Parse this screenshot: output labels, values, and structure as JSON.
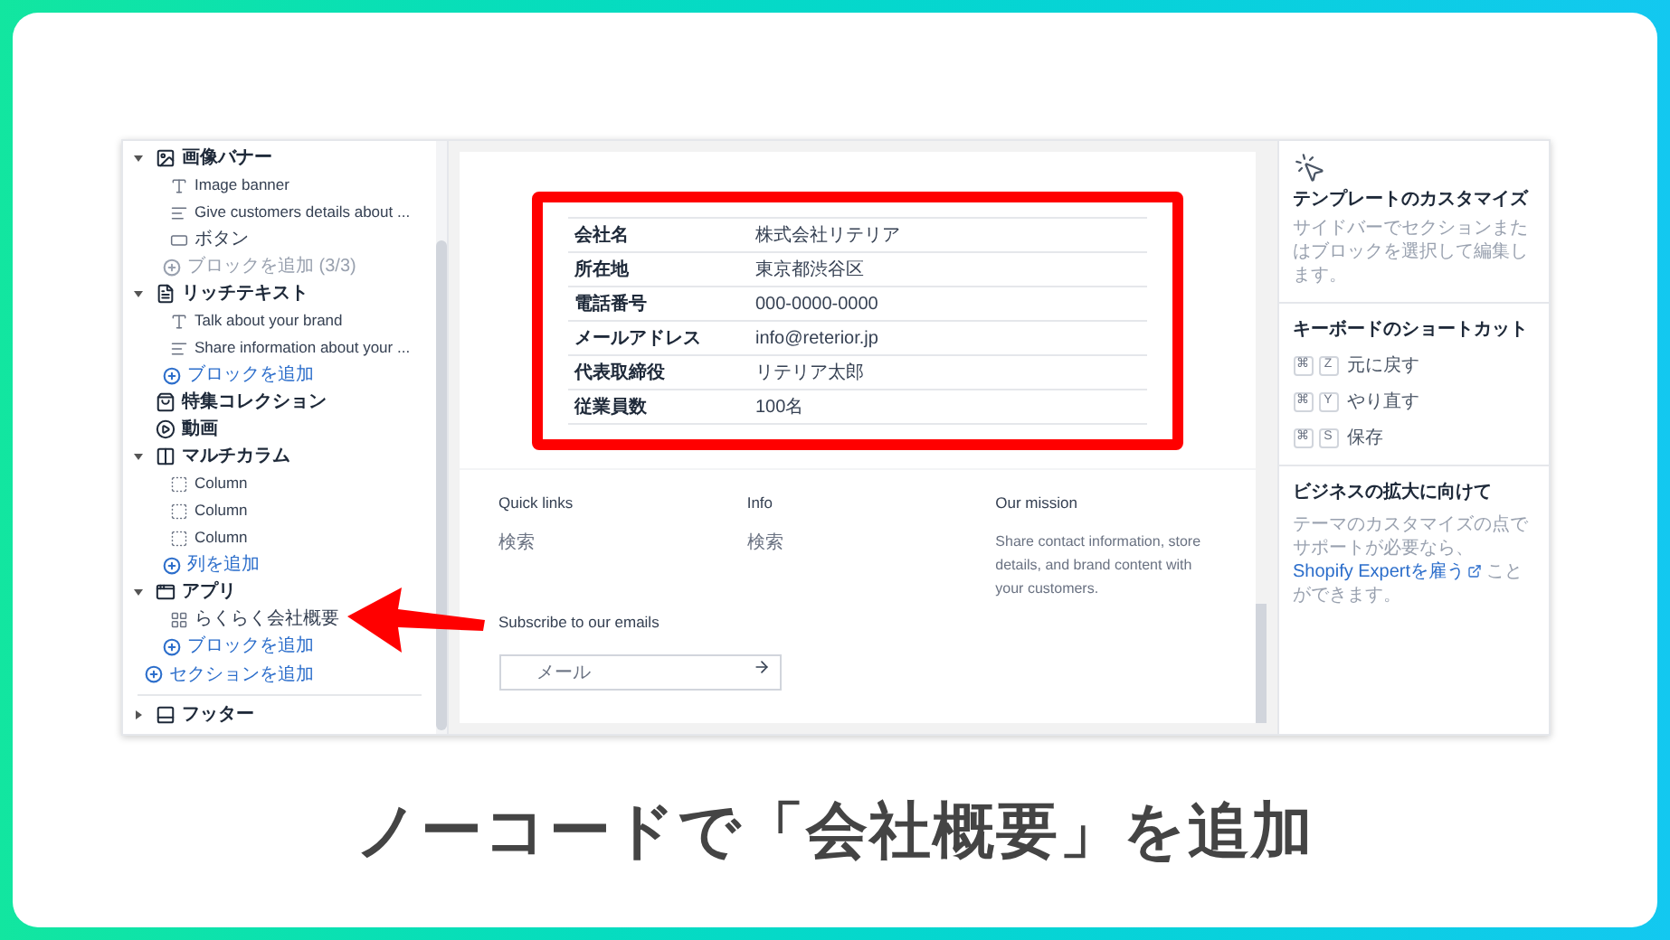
{
  "sidebar": {
    "sections": [
      {
        "title": "画像バナー",
        "kind": "image",
        "expanded": true,
        "children": [
          {
            "label": "Image banner",
            "kind": "heading"
          },
          {
            "label": "Give customers details about ...",
            "kind": "paragraph"
          },
          {
            "label": "ボタン",
            "kind": "button"
          },
          {
            "label": "ブロックを追加 (3/3)",
            "kind": "add",
            "disabled": true
          }
        ]
      },
      {
        "title": "リッチテキスト",
        "kind": "text",
        "expanded": true,
        "children": [
          {
            "label": "Talk about your brand",
            "kind": "heading"
          },
          {
            "label": "Share information about your ...",
            "kind": "paragraph"
          },
          {
            "label": "ブロックを追加",
            "kind": "add",
            "disabled": false
          }
        ]
      },
      {
        "title": "特集コレクション",
        "kind": "collection"
      },
      {
        "title": "動画",
        "kind": "video"
      },
      {
        "title": "マルチカラム",
        "kind": "columns",
        "expanded": true,
        "children": [
          {
            "label": "Column",
            "kind": "column"
          },
          {
            "label": "Column",
            "kind": "column"
          },
          {
            "label": "Column",
            "kind": "column"
          },
          {
            "label": "列を追加",
            "kind": "add",
            "disabled": false
          }
        ]
      },
      {
        "title": "アプリ",
        "kind": "app",
        "expanded": true,
        "children": [
          {
            "label": "らくらく会社概要",
            "kind": "app"
          },
          {
            "label": "ブロックを追加",
            "kind": "add",
            "disabled": false
          }
        ]
      }
    ],
    "add_section": "セクションを追加",
    "footer": {
      "title": "フッター",
      "kind": "footer",
      "expanded": false
    }
  },
  "preview": {
    "company_table": [
      {
        "label": "会社名",
        "value": "株式会社リテリア"
      },
      {
        "label": "所在地",
        "value": "東京都渋谷区"
      },
      {
        "label": "電話番号",
        "value": "000-0000-0000"
      },
      {
        "label": "メールアドレス",
        "value": "info@reterior.jp"
      },
      {
        "label": "代表取締役",
        "value": "リテリア太郎"
      },
      {
        "label": "従業員数",
        "value": "100名"
      }
    ],
    "footer": {
      "columns": [
        {
          "heading": "Quick links",
          "text": "検索"
        },
        {
          "heading": "Info",
          "text": "検索"
        },
        {
          "heading": "Our mission",
          "text": "Share contact information, store details, and brand content with your customers."
        }
      ],
      "subscribe_heading": "Subscribe to our emails",
      "email_placeholder": "メール"
    }
  },
  "right_panel": {
    "title": "テンプレートのカスタマイズ",
    "description": "サイドバーでセクションまたはブロックを選択して編集します。",
    "shortcuts_heading": "キーボードのショートカット",
    "shortcuts": [
      {
        "keys": [
          "⌘",
          "Z"
        ],
        "label": "元に戻す"
      },
      {
        "keys": [
          "⌘",
          "Y"
        ],
        "label": "やり直す"
      },
      {
        "keys": [
          "⌘",
          "S"
        ],
        "label": "保存"
      }
    ],
    "business_heading": "ビジネスの拡大に向けて",
    "business_text_before": "テーマのカスタマイズの点でサポートが必要なら、",
    "business_link": "Shopify Expertを雇う",
    "business_text_after": "ことができます。"
  },
  "caption": "ノーコードで「会社概要」を追加"
}
